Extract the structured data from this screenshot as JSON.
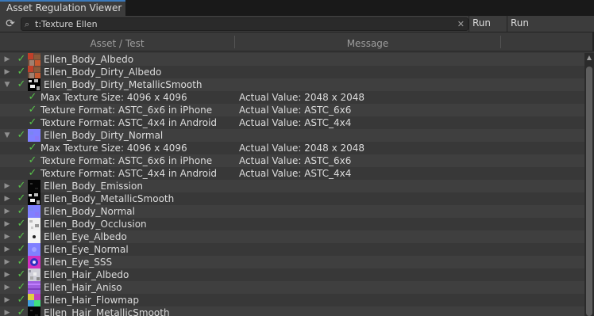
{
  "window": {
    "tab_title": "Asset Regulation Viewer"
  },
  "toolbar": {
    "refresh_icon": "refresh-icon",
    "search_value": "t:Texture Ellen",
    "search_icon": "search-icon",
    "clear_icon": "close-icon",
    "run_all_label": "Run All",
    "run_selected_label": "Run Selected"
  },
  "columns": {
    "asset": "Asset / Test",
    "message": "Message"
  },
  "colors": {
    "check": "#58c24a",
    "tab_accent": "#3a79bb",
    "background": "#383838"
  },
  "rows": [
    {
      "kind": "asset",
      "expanded": false,
      "name": "Ellen_Body_Albedo",
      "thumb": "albedo"
    },
    {
      "kind": "asset",
      "expanded": false,
      "name": "Ellen_Body_Dirty_Albedo",
      "thumb": "albedo"
    },
    {
      "kind": "asset",
      "expanded": true,
      "name": "Ellen_Body_Dirty_MetallicSmooth",
      "thumb": "bw"
    },
    {
      "kind": "test",
      "name": "Max Texture Size: 4096 x 4096",
      "message": "Actual Value: 2048 x 2048"
    },
    {
      "kind": "test",
      "name": "Texture Format: ASTC_6x6 in iPhone",
      "message": "Actual Value: ASTC_6x6"
    },
    {
      "kind": "test",
      "name": "Texture Format: ASTC_4x4 in Android",
      "message": "Actual Value: ASTC_4x4"
    },
    {
      "kind": "asset",
      "expanded": true,
      "name": "Ellen_Body_Dirty_Normal",
      "thumb": "normal"
    },
    {
      "kind": "test",
      "name": "Max Texture Size: 4096 x 4096",
      "message": "Actual Value: 2048 x 2048"
    },
    {
      "kind": "test",
      "name": "Texture Format: ASTC_6x6 in iPhone",
      "message": "Actual Value: ASTC_6x6"
    },
    {
      "kind": "test",
      "name": "Texture Format: ASTC_4x4 in Android",
      "message": "Actual Value: ASTC_4x4"
    },
    {
      "kind": "asset",
      "expanded": false,
      "name": "Ellen_Body_Emission",
      "thumb": "dark"
    },
    {
      "kind": "asset",
      "expanded": false,
      "name": "Ellen_Body_MetallicSmooth",
      "thumb": "bw"
    },
    {
      "kind": "asset",
      "expanded": false,
      "name": "Ellen_Body_Normal",
      "thumb": "normal"
    },
    {
      "kind": "asset",
      "expanded": false,
      "name": "Ellen_Body_Occlusion",
      "thumb": "occlusion"
    },
    {
      "kind": "asset",
      "expanded": false,
      "name": "Ellen_Eye_Albedo",
      "thumb": "eye"
    },
    {
      "kind": "asset",
      "expanded": false,
      "name": "Ellen_Eye_Normal",
      "thumb": "eyenormal"
    },
    {
      "kind": "asset",
      "expanded": false,
      "name": "Ellen_Eye_SSS",
      "thumb": "sss"
    },
    {
      "kind": "asset",
      "expanded": false,
      "name": "Ellen_Hair_Albedo",
      "thumb": "hair"
    },
    {
      "kind": "asset",
      "expanded": false,
      "name": "Ellen_Hair_Aniso",
      "thumb": "aniso"
    },
    {
      "kind": "asset",
      "expanded": false,
      "name": "Ellen_Hair_Flowmap",
      "thumb": "flow"
    },
    {
      "kind": "asset",
      "expanded": false,
      "name": "Ellen_Hair_MetallicSmooth",
      "thumb": "dark"
    }
  ]
}
